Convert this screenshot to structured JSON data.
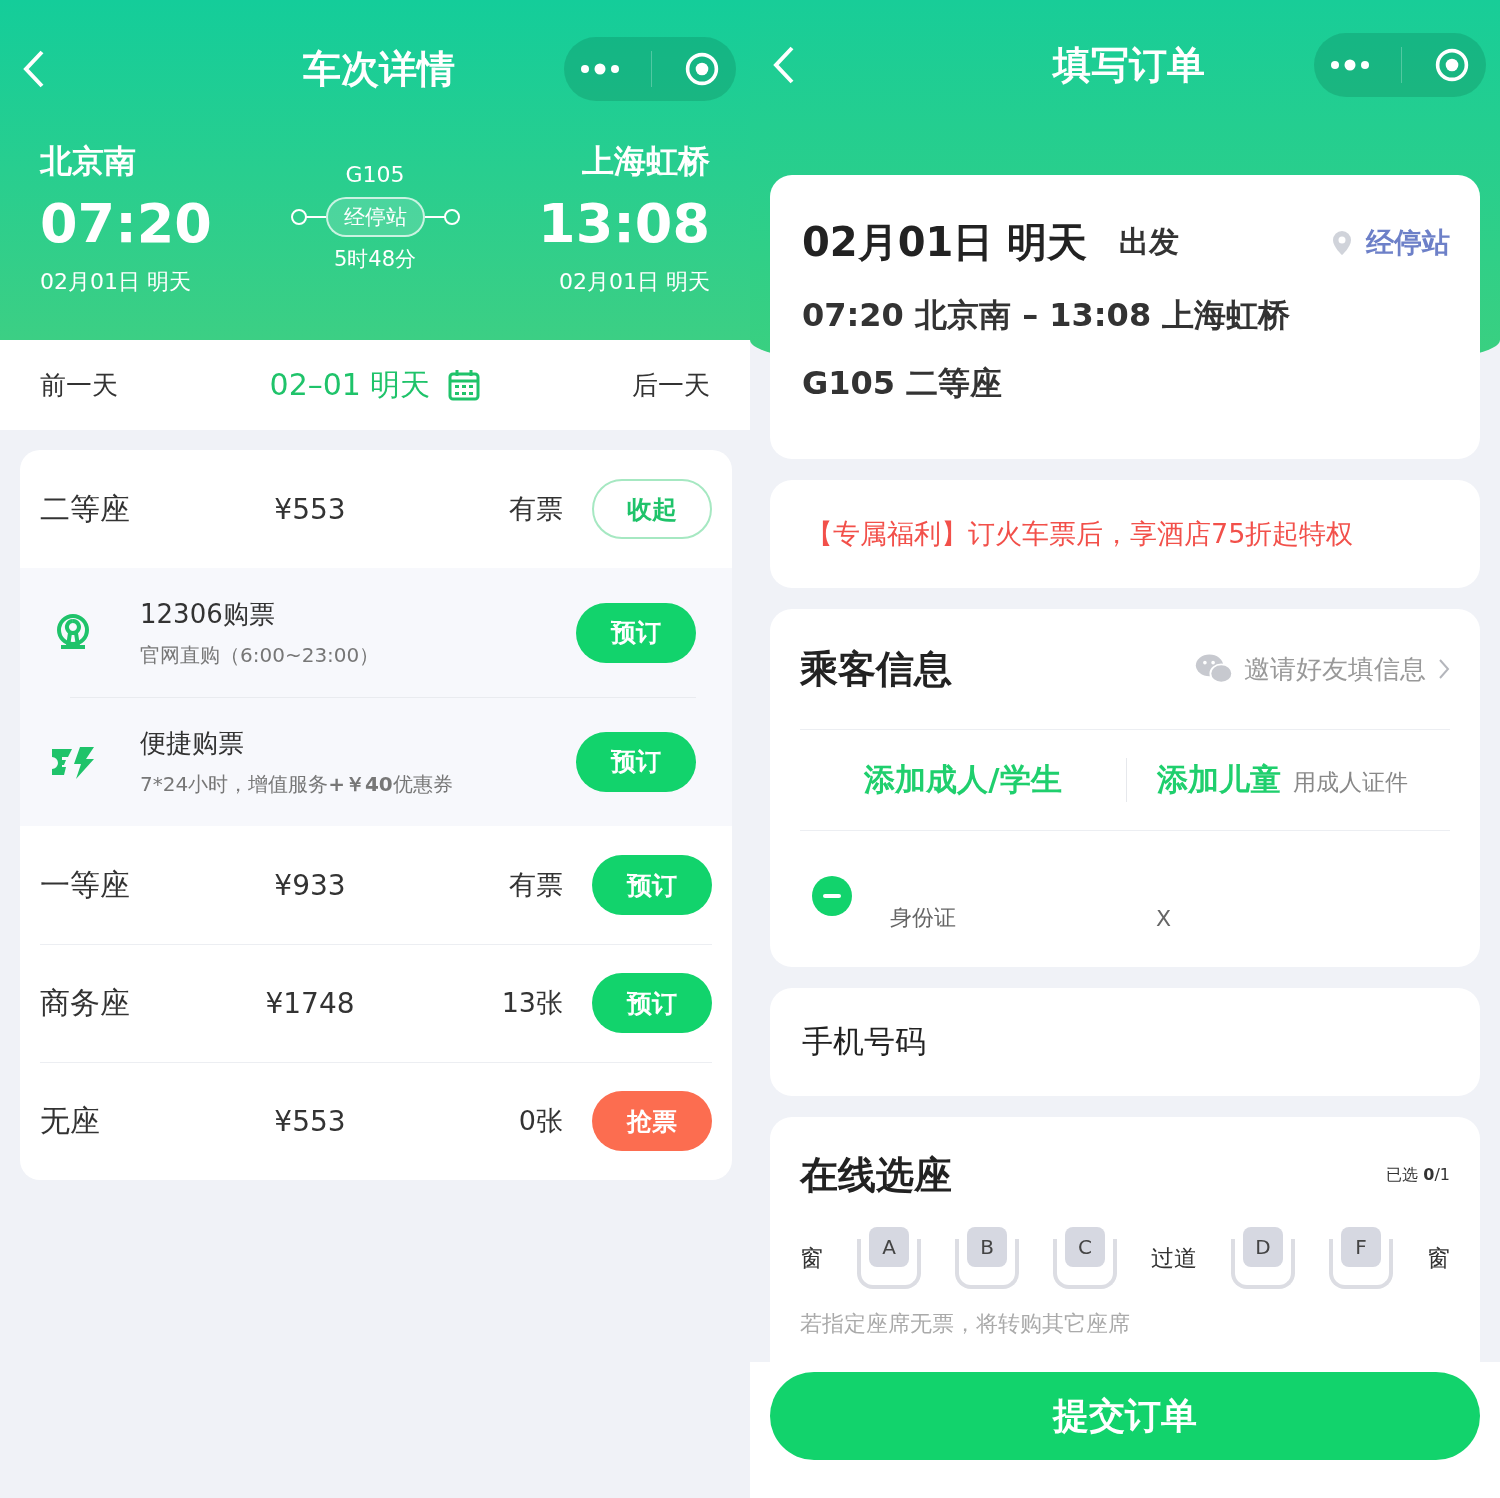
{
  "trip_detail": {
    "nav_title": "车次详情",
    "departure": {
      "station": "北京南",
      "time": "07:20",
      "date": "02月01日 明天"
    },
    "train": {
      "number": "G105",
      "stops_label": "经停站",
      "duration": "5时48分"
    },
    "arrival": {
      "station": "上海虹桥",
      "time": "13:08",
      "date": "02月01日 明天"
    },
    "date_bar": {
      "prev": "前一天",
      "current": "02–01 明天",
      "next": "后一天"
    },
    "seats": [
      {
        "name": "二等座",
        "price": "¥553",
        "availability": "有票",
        "action": {
          "label": "收起",
          "kind": "collapse"
        },
        "options": [
          {
            "title": "12306购票",
            "subtitle": "官网直购（6:00~23:00）",
            "action": "预订"
          },
          {
            "title": "便捷购票",
            "subtitle": "7*24小时，增值服务**+￥40**优惠券",
            "action": "预订"
          }
        ]
      },
      {
        "name": "一等座",
        "price": "¥933",
        "availability": "有票",
        "action": {
          "label": "预订",
          "kind": "book"
        }
      },
      {
        "name": "商务座",
        "price": "¥1748",
        "availability": "13张",
        "action": {
          "label": "预订",
          "kind": "book"
        }
      },
      {
        "name": "无座",
        "price": "¥553",
        "availability": "0张",
        "action": {
          "label": "抢票",
          "kind": "grab"
        }
      }
    ]
  },
  "order_form": {
    "nav_title": "填写订单",
    "trip": {
      "date": "02月01日 明天",
      "depart_word": "出发",
      "stops_link": "经停站",
      "route": "07:20 北京南 – 13:08 上海虹桥",
      "train_seat": "G105 二等座"
    },
    "promo": "【专属福利】订火车票后，享酒店75折起特权",
    "passengers": {
      "title": "乘客信息",
      "invite": "邀请好友填信息",
      "add_adult": "添加成人/学生",
      "add_child": "添加儿童",
      "add_child_note": "用成人证件",
      "list": [
        {
          "id_label": "身份证",
          "id_tail": "X"
        }
      ]
    },
    "phone": {
      "label": "手机号码"
    },
    "seat_picker": {
      "title": "在线选座",
      "count": "已选 **0**/1",
      "row": [
        {
          "kind": "label",
          "text": "窗"
        },
        {
          "kind": "seat",
          "text": "A",
          "selected": false
        },
        {
          "kind": "seat",
          "text": "B",
          "selected": false
        },
        {
          "kind": "seat",
          "text": "C",
          "selected": false
        },
        {
          "kind": "label",
          "text": "过道"
        },
        {
          "kind": "seat",
          "text": "D",
          "selected": false
        },
        {
          "kind": "seat",
          "text": "F",
          "selected": false
        },
        {
          "kind": "label",
          "text": "窗"
        }
      ],
      "note": "若指定座席无票，将转购其它座席"
    },
    "submit": "提交订单"
  }
}
